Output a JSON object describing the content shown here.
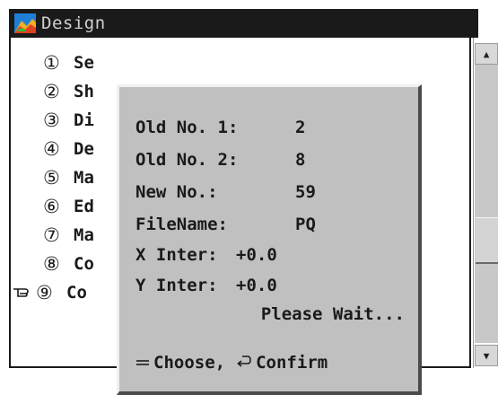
{
  "window": {
    "title": "Design",
    "icon": "design-app-icon"
  },
  "menu": {
    "pointer_icon": "hand-pointer-icon",
    "selected_index": 8,
    "items": [
      {
        "num": "①",
        "label": "Se"
      },
      {
        "num": "②",
        "label": "Sh"
      },
      {
        "num": "③",
        "label": "Di"
      },
      {
        "num": "④",
        "label": "De"
      },
      {
        "num": "⑤",
        "label": "Ma"
      },
      {
        "num": "⑥",
        "label": "Ed"
      },
      {
        "num": "⑦",
        "label": "Ma"
      },
      {
        "num": "⑧",
        "label": "Co"
      },
      {
        "num": "⑨",
        "label": "Co"
      }
    ]
  },
  "dialog": {
    "old_no_1_label": "Old No. 1:",
    "old_no_1_value": "2",
    "old_no_2_label": "Old No. 2:",
    "old_no_2_value": "8",
    "new_no_label": "New No.:",
    "new_no_value": "59",
    "filename_label": "FileName:",
    "filename_value": "PQ",
    "x_inter_label": "X Inter:",
    "x_inter_value": "+0.0",
    "y_inter_label": "Y Inter:",
    "y_inter_value": "+0.0",
    "status": "Please Wait...",
    "footer_choose": "Choose,",
    "footer_confirm": "Confirm",
    "choose_icon": "arrow-keys-icon",
    "confirm_icon": "enter-key-icon"
  },
  "colors": {
    "titlebar": "#1a1a1a",
    "dialog_bg": "#c0c0c0",
    "title_text": "#cfcfcf"
  }
}
